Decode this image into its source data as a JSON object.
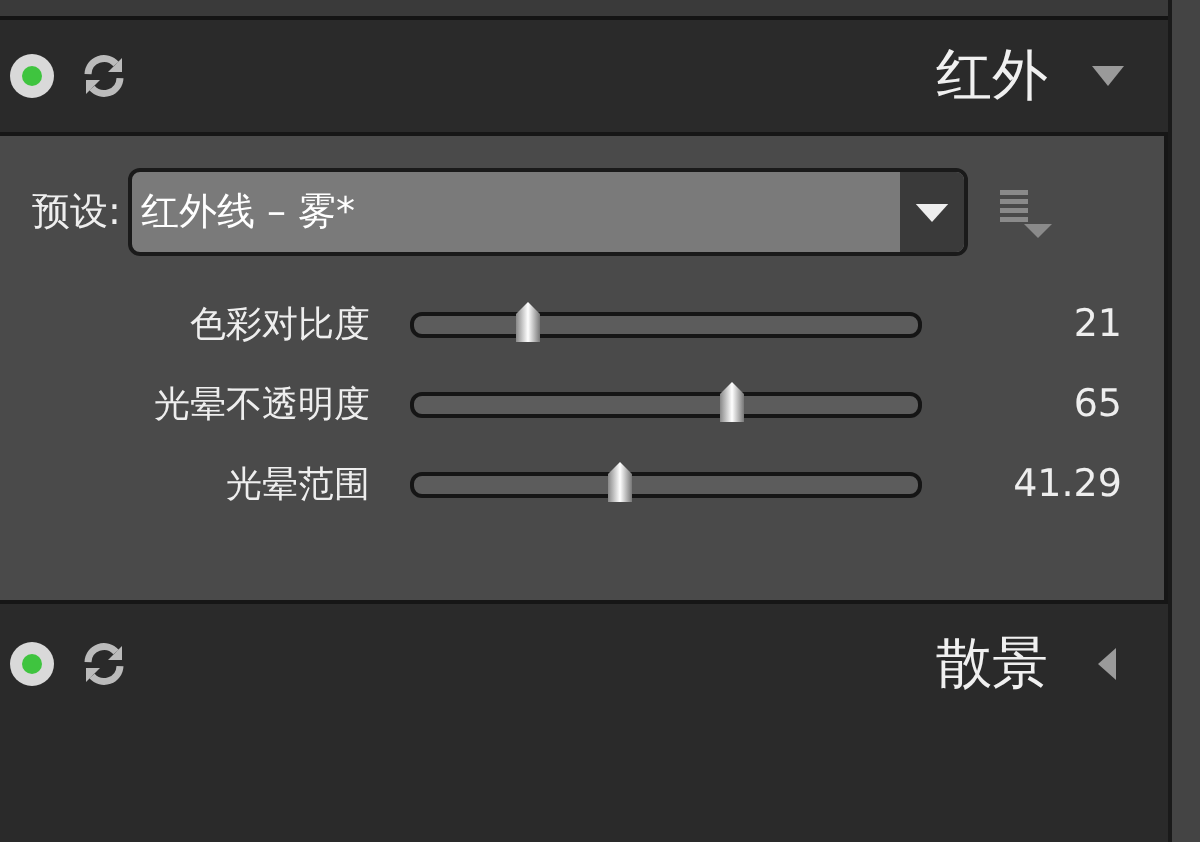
{
  "sections": [
    {
      "title": "红外",
      "on": true,
      "expanded": true,
      "preset": {
        "label": "预设:",
        "value": "红外线 – 雾*"
      },
      "sliders": [
        {
          "label": "色彩对比度",
          "level": 0.23,
          "reading": "21"
        },
        {
          "label": "光晕不透明度",
          "level": 0.63,
          "reading": "65"
        },
        {
          "label": "光晕范围",
          "level": 0.41,
          "reading": "41.29"
        }
      ]
    },
    {
      "title": "散景",
      "on": true,
      "expanded": false
    }
  ]
}
